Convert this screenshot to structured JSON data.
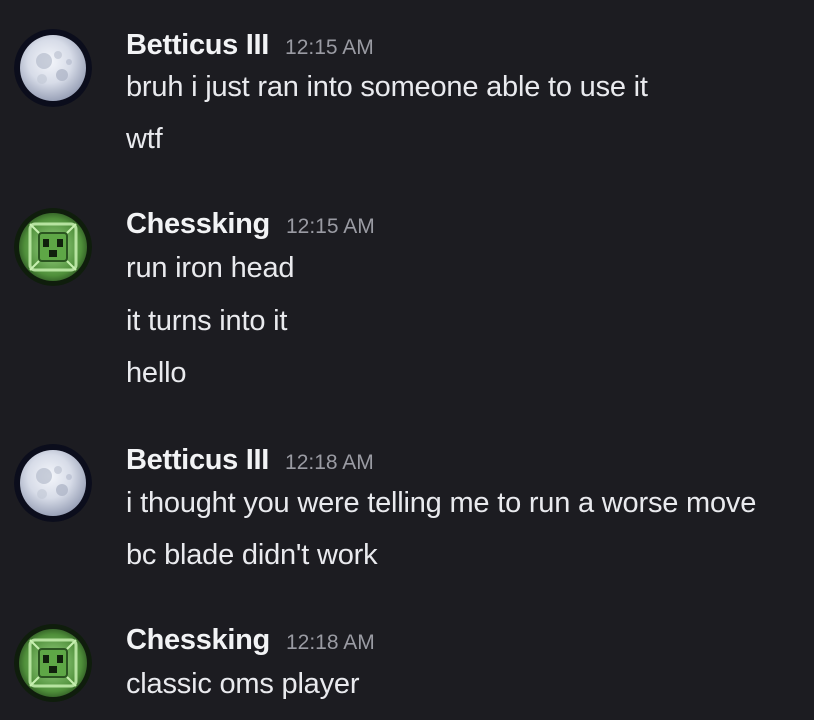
{
  "messages": [
    {
      "author": "Betticus III",
      "time": "12:15 AM",
      "avatar_icon": "moon-avatar-icon",
      "lines": [
        "bruh i just ran into someone able to use it",
        "wtf"
      ]
    },
    {
      "author": "Chessking",
      "time": "12:15 AM",
      "avatar_icon": "green-cube-avatar-icon",
      "lines": [
        "run iron head",
        "it turns into it",
        "hello"
      ]
    },
    {
      "author": "Betticus III",
      "time": "12:18 AM",
      "avatar_icon": "moon-avatar-icon",
      "lines": [
        "i thought you were telling me to run a worse move",
        "bc blade didn't work"
      ]
    },
    {
      "author": "Chessking",
      "time": "12:18 AM",
      "avatar_icon": "green-cube-avatar-icon",
      "lines": [
        "classic oms player"
      ]
    }
  ],
  "colors": {
    "background": "#1c1c21",
    "username": "#f2f3f5",
    "timestamp": "#9a9ba3",
    "text": "#e9eaee"
  }
}
